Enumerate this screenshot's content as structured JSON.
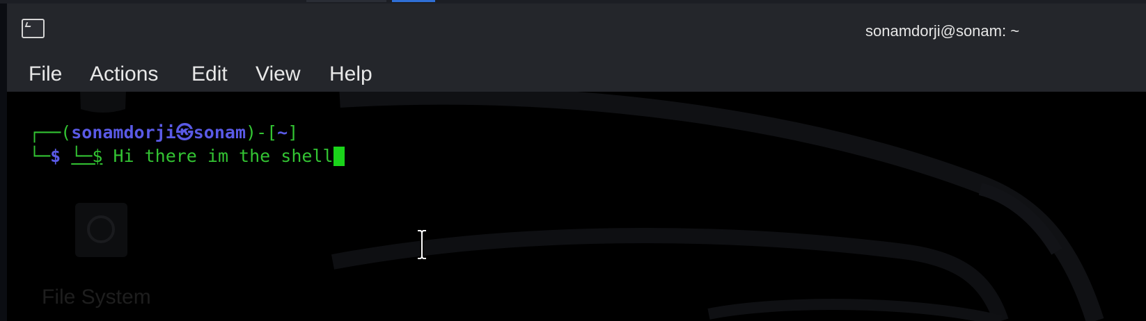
{
  "window": {
    "title": "sonamdorji@sonam: ~"
  },
  "menu": {
    "items": [
      "File",
      "Actions",
      "Edit",
      "View",
      "Help"
    ]
  },
  "desktop": {
    "icon_label": "File System"
  },
  "terminal": {
    "line1": {
      "frame_open": "┌──(",
      "user": "sonamdorji",
      "at_symbol": "㉿",
      "host": "sonam",
      "mid": ")-[",
      "cwd": "~",
      "frame_close": "]"
    },
    "line2": {
      "frame": "└─",
      "prompt": "$",
      "pasted_prompt": "└─$",
      "command": " Hi there im the shell"
    }
  },
  "icons": {
    "window_icon": "terminal-icon",
    "mouse_cursor": "text-cursor-icon"
  },
  "colors": {
    "titlebar_bg": "#24262b",
    "terminal_bg": "#000000",
    "prompt_green": "#33c433",
    "prompt_blue": "#5a5ae6",
    "cursor_green": "#1ad41a",
    "panel_accent": "#2f6fd6"
  }
}
